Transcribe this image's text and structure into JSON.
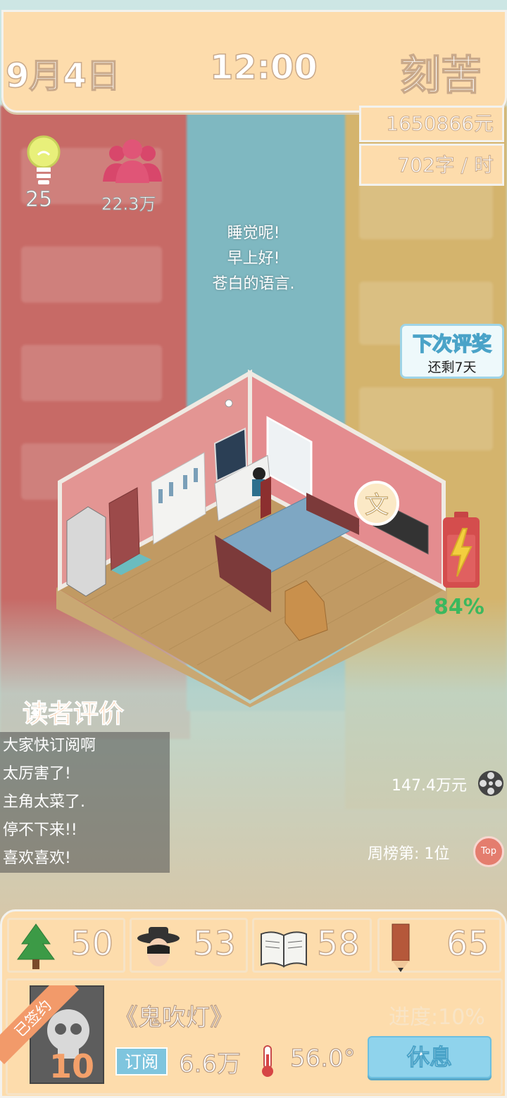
{
  "header": {
    "date": "9月4日",
    "time": "12:00",
    "mode": "刻苦"
  },
  "stats": {
    "money": "1650866元",
    "speed": "702字 / 时"
  },
  "hud": {
    "ideas": "25",
    "fans": "22.3万"
  },
  "dialog": [
    "睡觉呢!",
    "早上好!",
    "苍白的语言."
  ],
  "award": {
    "title": "下次评奖",
    "subtitle": "还剩7天"
  },
  "room": {
    "bubble": "文"
  },
  "battery": {
    "percent": "84%",
    "level": 0.84
  },
  "reviews": {
    "title": "读者评价",
    "items": [
      "大家快订阅啊",
      "太厉害了!",
      "主角太菜了.",
      "停不下来!!",
      "喜欢喜欢!"
    ]
  },
  "income": "147.4万元",
  "rank": "周榜第: 1位",
  "top_badge": "Top",
  "attributes": [
    {
      "icon": "tree-icon",
      "value": "50"
    },
    {
      "icon": "character-icon",
      "value": "53"
    },
    {
      "icon": "book-icon",
      "value": "58"
    },
    {
      "icon": "pencil-icon",
      "value": "65"
    }
  ],
  "book": {
    "status": "已签约",
    "cover_number": "10",
    "title": "《鬼吹灯》",
    "progress": "进度:10%",
    "subscribe_label": "订阅",
    "subscribers": "6.6万",
    "heat": "56.0°",
    "rest_button": "休息"
  }
}
